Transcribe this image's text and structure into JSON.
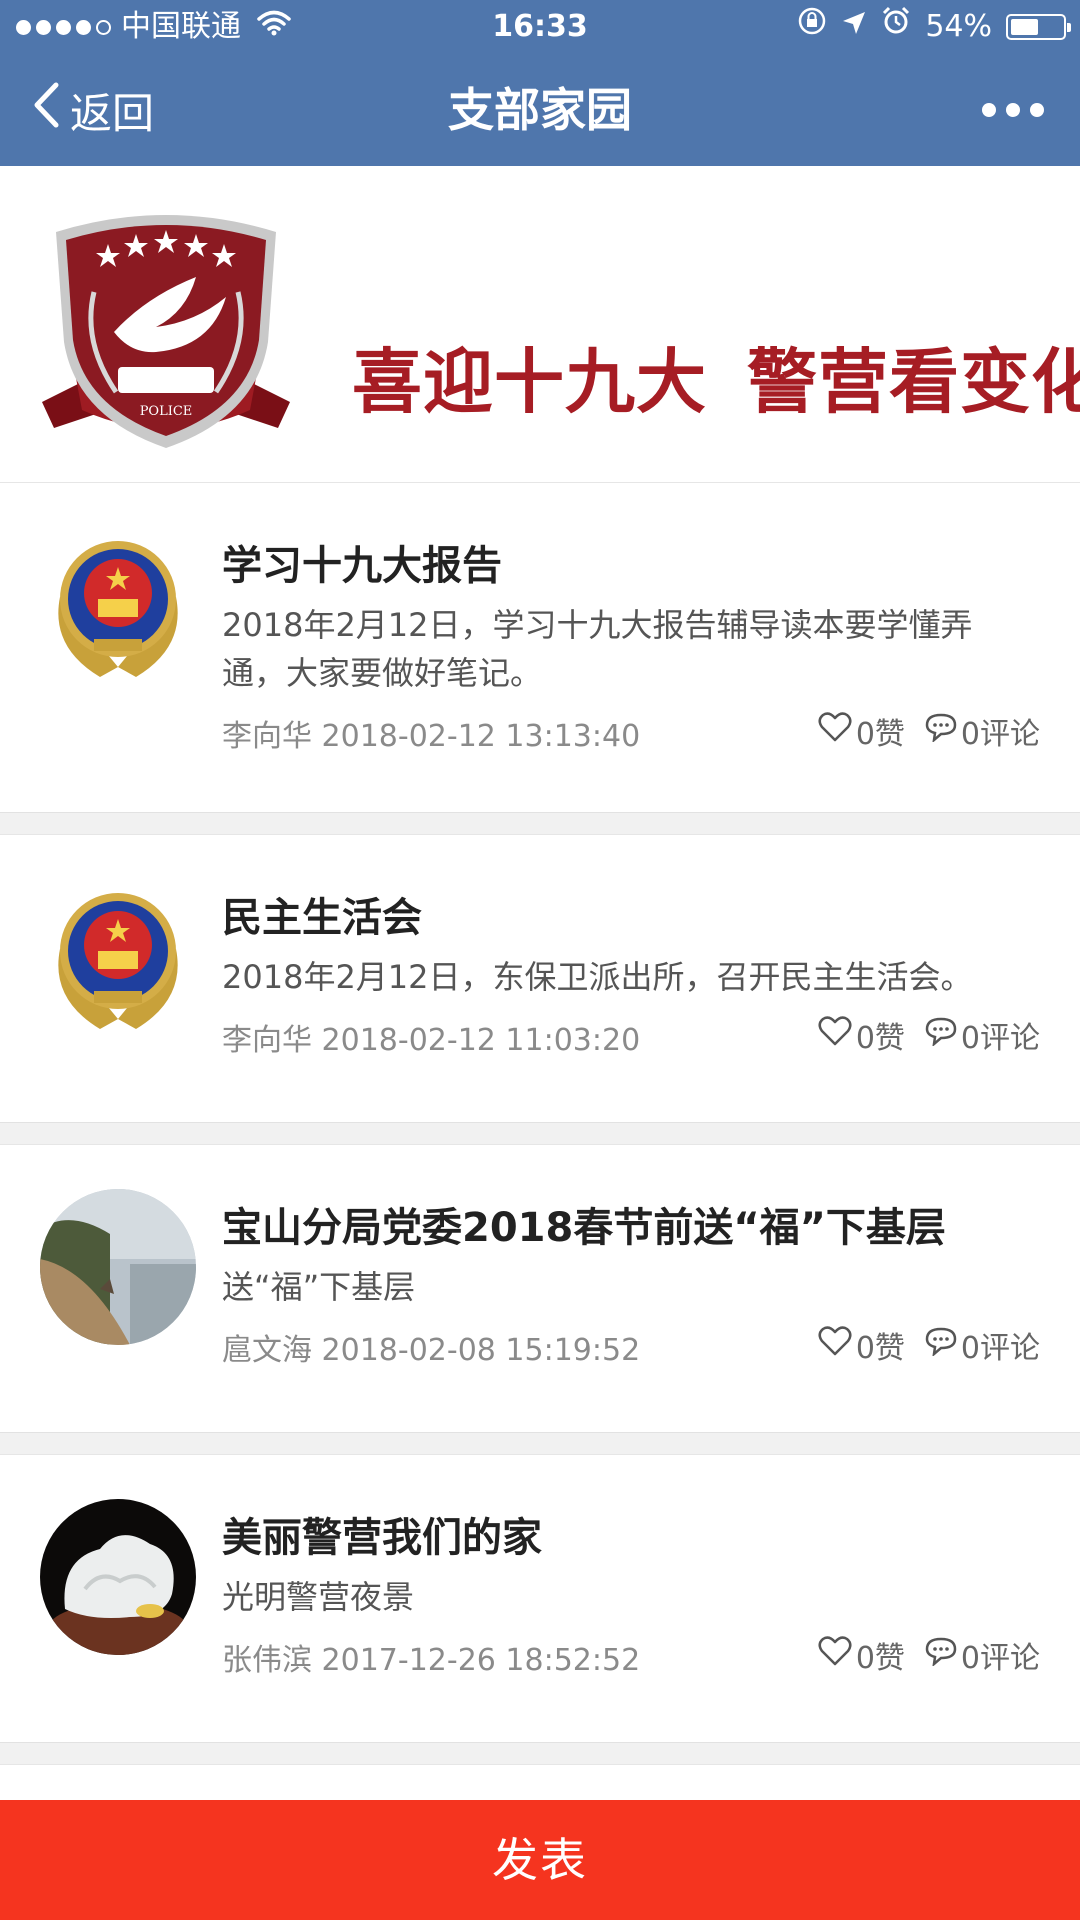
{
  "status_bar": {
    "carrier": "中国联通",
    "time": "16:33",
    "battery_text": "54%",
    "battery_level": 0.54
  },
  "nav": {
    "back_label": "返回",
    "title": "支部家园"
  },
  "banner": {
    "slogan_part1": "喜迎十九大",
    "slogan_part2": "警营看变化",
    "emblem_text": "POLICE"
  },
  "posts": [
    {
      "title": "学习十九大报告",
      "desc": "2018年2月12日，学习十九大报告辅导读本要学懂弄通，大家要做好笔记。",
      "author": "李向华",
      "datetime": "2018-02-12 13:13:40",
      "likes": "0赞",
      "comments": "0评论",
      "avatar": "police-badge"
    },
    {
      "title": "民主生活会",
      "desc": "2018年2月12日，东保卫派出所，召开民主生活会。",
      "author": "李向华",
      "datetime": "2018-02-12 11:03:20",
      "likes": "0赞",
      "comments": "0评论",
      "avatar": "police-badge"
    },
    {
      "title": "宝山分局党委2018春节前送“福”下基层",
      "desc": "送“福”下基层",
      "author": "扈文海",
      "datetime": "2018-02-08 15:19:52",
      "likes": "0赞",
      "comments": "0评论",
      "avatar": "beach-photo"
    },
    {
      "title": "美丽警营我们的家",
      "desc": "光明警营夜景",
      "author": "张伟滨",
      "datetime": "2017-12-26 18:52:52",
      "likes": "0赞",
      "comments": "0评论",
      "avatar": "jade-carving-photo"
    }
  ],
  "publish_label": "发表",
  "colors": {
    "nav_bg": "#4f76ac",
    "publish_bg": "#f5341f",
    "slogan": "#a61d24"
  }
}
